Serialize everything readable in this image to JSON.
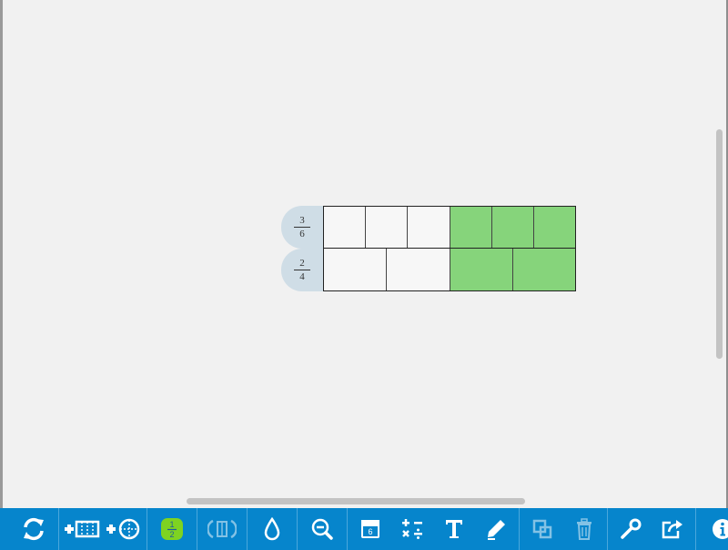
{
  "bars": [
    {
      "label_numerator": "3",
      "label_denominator": "6",
      "parts": 6,
      "shaded": [
        false,
        false,
        false,
        true,
        true,
        true
      ]
    },
    {
      "label_numerator": "2",
      "label_denominator": "4",
      "parts": 4,
      "shaded": [
        false,
        false,
        true,
        true
      ]
    }
  ],
  "colors": {
    "toolbar": "#0685cc",
    "shaded_cell": "#86d47b",
    "label_tab": "#cfdde6",
    "fraction_badge": "#7ed321"
  },
  "toolbar": {
    "fraction_badge_numerator": "1",
    "fraction_badge_denominator": "2",
    "icons": [
      "refresh-icon",
      "add-bar-icon",
      "add-circle-icon",
      "fraction-label-icon",
      "split-icon",
      "fill-color-icon",
      "zoom-out-icon",
      "calculator-icon",
      "operations-icon",
      "text-icon",
      "pen-icon",
      "duplicate-icon",
      "trash-icon",
      "key-icon",
      "share-icon",
      "info-icon"
    ]
  }
}
